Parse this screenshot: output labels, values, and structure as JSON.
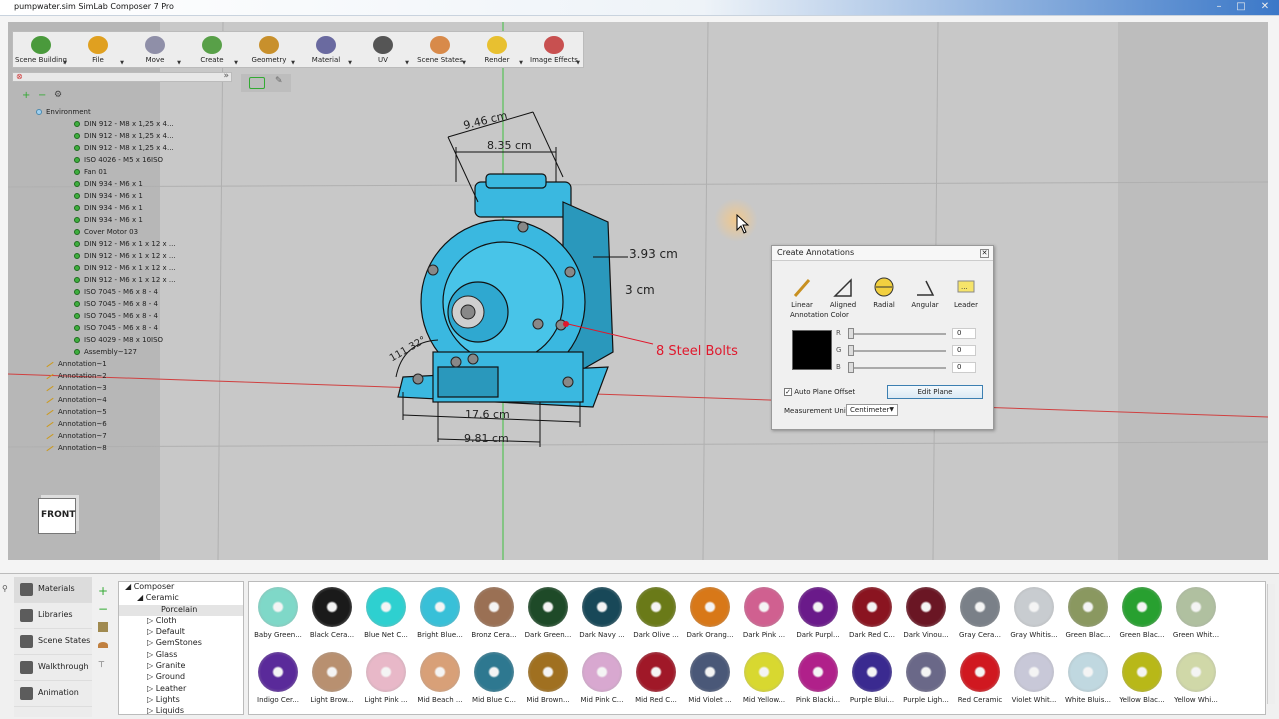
{
  "window": {
    "title": "pumpwater.sim SimLab Composer 7 Pro"
  },
  "toolbar": {
    "items": [
      {
        "label": "Scene Building",
        "icon": "scene-building-icon",
        "color": "#4a9a3c"
      },
      {
        "label": "File",
        "icon": "folder-icon",
        "color": "#e0a020"
      },
      {
        "label": "Move",
        "icon": "move-icon",
        "color": "#8f8fa8"
      },
      {
        "label": "Create",
        "icon": "create-cube-icon",
        "color": "#58a048"
      },
      {
        "label": "Geometry",
        "icon": "geometry-icon",
        "color": "#c8902c"
      },
      {
        "label": "Material",
        "icon": "material-icon",
        "color": "#6a6aa0"
      },
      {
        "label": "UV",
        "icon": "uv-checker-icon",
        "color": "#555555"
      },
      {
        "label": "Scene States",
        "icon": "scene-states-icon",
        "color": "#d88a4a"
      },
      {
        "label": "Render",
        "icon": "render-icon",
        "color": "#e8c030"
      },
      {
        "label": "Image Effects",
        "icon": "image-effects-icon",
        "color": "#c85050"
      }
    ]
  },
  "tree": {
    "root": "Environment",
    "items": [
      "DIN 912 - M8 x 1,25 x 4...",
      "DIN 912 - M8 x 1,25 x 4...",
      "DIN 912 - M8 x 1,25 x 4...",
      "ISO 4026 - M5 x 16ISO",
      "Fan 01",
      "DIN 934 - M6 x 1",
      "DIN 934 - M6 x 1",
      "DIN 934 - M6 x 1",
      "DIN 934 - M6 x 1",
      "Cover Motor 03",
      "DIN 912 - M6 x 1 x 12 x ...",
      "DIN 912 - M6 x 1 x 12 x ...",
      "DIN 912 - M6 x 1 x 12 x ...",
      "DIN 912 - M6 x 1 x 12 x ...",
      "ISO 7045 - M6 x 8 - 4",
      "ISO 7045 - M6 x 8 - 4",
      "ISO 7045 - M6 x 8 - 4",
      "ISO 7045 - M6 x 8 - 4",
      "ISO 4029 - M8 x 10ISO",
      "Assembly~127"
    ],
    "annotations": [
      "Annotation~1",
      "Annotation~2",
      "Annotation~3",
      "Annotation~4",
      "Annotation~5",
      "Annotation~6",
      "Annotation~7",
      "Annotation~8"
    ]
  },
  "viewport": {
    "nav_cube_label": "FRONT",
    "dims": {
      "d1": "9.46 cm",
      "d2": "8.35 cm",
      "d3": "3.93 cm",
      "d4": "3 cm",
      "d5": "111.32°",
      "d6": "17.6 cm",
      "d7": "9.81 cm"
    },
    "leader_text": "8 Steel Bolts",
    "leader_color": "#e0182c",
    "motor_color": "#3ab8e0"
  },
  "annotations_panel": {
    "title": "Create Annotations",
    "tools": [
      "Linear",
      "Aligned",
      "Radial",
      "Angular",
      "Leader"
    ],
    "color_label": "Annotation Color",
    "color": "#000000",
    "r": "0",
    "g": "0",
    "b": "0",
    "auto_plane_offset": "Auto Plane Offset",
    "edit_plane": "Edit Plane",
    "measurement_unit_label": "Measurement Unit",
    "measurement_unit": "Centimeter"
  },
  "bottom": {
    "nav": [
      "Materials",
      "Libraries",
      "Scene States",
      "Walkthrough",
      "Animation"
    ],
    "material_tree": [
      "Composer",
      "Ceramic",
      "Porcelain",
      "Cloth",
      "Default",
      "GemStones",
      "Glass",
      "Granite",
      "Ground",
      "Leather",
      "Lights",
      "Liquids"
    ],
    "swatches_row1": [
      {
        "name": "Baby Green...",
        "color": "#7fd8c8"
      },
      {
        "name": "Black Cera...",
        "color": "#1a1a1a"
      },
      {
        "name": "Blue Net C...",
        "color": "#2ed0d0"
      },
      {
        "name": "Bright Blue...",
        "color": "#38c0d8"
      },
      {
        "name": "Bronz Cera...",
        "color": "#9a7054"
      },
      {
        "name": "Dark Green...",
        "color": "#1e4a28"
      },
      {
        "name": "Dark Navy ...",
        "color": "#184858"
      },
      {
        "name": "Dark Olive ...",
        "color": "#6a7a18"
      },
      {
        "name": "Dark Orang...",
        "color": "#d87818"
      },
      {
        "name": "Dark Pink ...",
        "color": "#d06090"
      },
      {
        "name": "Dark Purpl...",
        "color": "#6a1a8a"
      },
      {
        "name": "Dark Red C...",
        "color": "#8a1420"
      },
      {
        "name": "Dark Vinou...",
        "color": "#6a1624"
      },
      {
        "name": "Gray Cera...",
        "color": "#7a8088"
      },
      {
        "name": "Gray Whitis...",
        "color": "#c8ccd0"
      },
      {
        "name": "Green Blac...",
        "color": "#8a9860"
      },
      {
        "name": "Green Blac...",
        "color": "#28a030"
      },
      {
        "name": "Green Whit...",
        "color": "#b0c0a0"
      }
    ],
    "swatches_row2": [
      {
        "name": "Indigo Cer...",
        "color": "#5a2a9a"
      },
      {
        "name": "Light Brow...",
        "color": "#b89070"
      },
      {
        "name": "Light Pink ...",
        "color": "#e8b8c8"
      },
      {
        "name": "Mid Beach ...",
        "color": "#d8a078"
      },
      {
        "name": "Mid Blue C...",
        "color": "#2e7890"
      },
      {
        "name": "Mid Brown...",
        "color": "#a07020"
      },
      {
        "name": "Mid Pink C...",
        "color": "#d8a8d0"
      },
      {
        "name": "Mid Red C...",
        "color": "#a01828"
      },
      {
        "name": "Mid Violet ...",
        "color": "#4a5878"
      },
      {
        "name": "Mid Yellow...",
        "color": "#d8d830"
      },
      {
        "name": "Pink Blacki...",
        "color": "#b0208a"
      },
      {
        "name": "Purple Blui...",
        "color": "#3a2a90"
      },
      {
        "name": "Purple Ligh...",
        "color": "#6a6888"
      },
      {
        "name": "Red Ceramic",
        "color": "#d01820"
      },
      {
        "name": "Violet Whit...",
        "color": "#c8c8d8"
      },
      {
        "name": "White Bluis...",
        "color": "#c0d8e0"
      },
      {
        "name": "Yellow Blac...",
        "color": "#b8b818"
      },
      {
        "name": "Yellow Whi...",
        "color": "#d0d8a8"
      }
    ]
  }
}
